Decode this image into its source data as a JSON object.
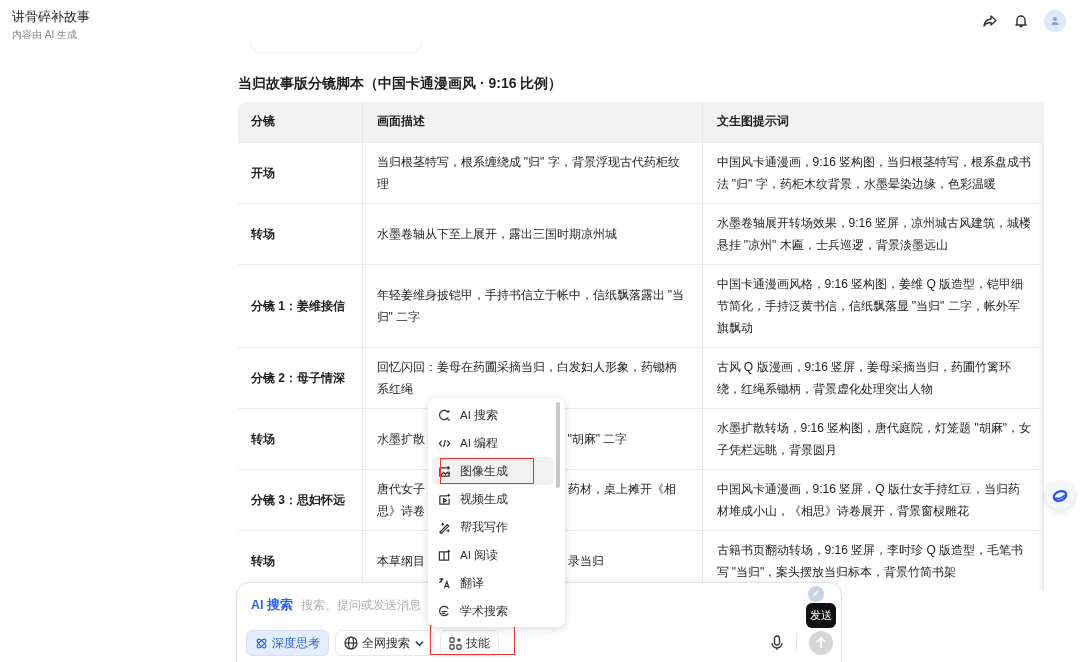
{
  "header": {
    "title": "讲骨碎补故事",
    "subtitle": "内容由 AI 生成"
  },
  "section_title": "当归故事版分镜脚本（中国卡通漫画风 · 9:16 比例）",
  "table": {
    "columns": [
      "分镜",
      "画面描述",
      "文生图提示词"
    ],
    "rows": [
      {
        "shot": "开场",
        "description": [
          [
            "当归根茎特写，根系缠绕成 \"归\" 字，背景浮现古代药柜纹理"
          ]
        ],
        "prompt": "中国风卡通漫画，9:16 竖构图，当归根茎特写，根系盘成书法 \"归\" 字，药柜木纹背景，水墨晕染边缘，色彩温暖"
      },
      {
        "shot": "转场",
        "description": [
          [
            "水墨卷轴从下至上展开，露出三国时期凉州城"
          ]
        ],
        "prompt": "水墨卷轴展开转场效果，9:16 竖屏，凉州城古风建筑，城楼悬挂 \"凉州\" 木匾，士兵巡逻，背景淡墨远山"
      },
      {
        "shot": "分镜 1：姜维接信",
        "description": [
          [
            "年轻姜维身披铠甲，手持书信立于帐中，信纸飘落露出 \"当归\" 二字"
          ]
        ],
        "prompt": "中国卡通漫画风格，9:16 竖构图，姜维 Q 版造型，铠甲细节简化，手持泛黄书信，信纸飘落显 \"当归\" 二字，帐外军旗飘动"
      },
      {
        "shot": "分镜 2：母子情深",
        "description": [
          [
            "回忆闪回：姜母在药圃采摘当归，白发妇人形象，药锄柄系红绳"
          ]
        ],
        "prompt": "古风 Q 版漫画，9:16 竖屏，姜母采摘当归，药圃竹篱环绕，红绳系锄柄，背景虚化处理突出人物"
      },
      {
        "shot": "转场",
        "description": [
          [
            "水墨扩散",
            "\"胡麻\" 二字"
          ]
        ],
        "prompt": "水墨扩散转场，9:16 竖构图，唐代庭院，灯笼题 \"胡麻\"，女子凭栏远眺，背景圆月"
      },
      {
        "shot": "分镜 3：思妇怀远",
        "description": [
          [
            "唐代女子",
            "药材，桌上摊开《相"
          ],
          [
            "思》诗卷"
          ]
        ],
        "prompt": "中国风卡通漫画，9:16 竖屏，Q 版仕女手持红豆，当归药材堆成小山，《相思》诗卷展开，背景窗棂雕花"
      },
      {
        "shot": "转场",
        "description": [
          [
            "本草纲目",
            "录当归"
          ]
        ],
        "prompt": "古籍书页翻动转场，9:16 竖屏，李时珍 Q 版造型，毛笔书写 \"当归\"，案头摆放当归标本，背景竹简书架"
      }
    ]
  },
  "menu": [
    {
      "label": "AI 搜索",
      "selected": false,
      "highlighted": false
    },
    {
      "label": "AI 编程",
      "selected": false,
      "highlighted": false
    },
    {
      "label": "图像生成",
      "selected": true,
      "highlighted": true
    },
    {
      "label": "视频生成",
      "selected": false,
      "highlighted": false
    },
    {
      "label": "帮我写作",
      "selected": false,
      "highlighted": false
    },
    {
      "label": "AI 阅读",
      "selected": false,
      "highlighted": false
    },
    {
      "label": "翻译",
      "selected": false,
      "highlighted": false
    },
    {
      "label": "学术搜索",
      "selected": false,
      "highlighted": false
    }
  ],
  "composer": {
    "mode": "AI 搜索",
    "placeholder": "搜索、提问或发送消息",
    "chips": [
      {
        "kind": "toggle",
        "label": "深度思考",
        "selected": true,
        "highlighted": false
      },
      {
        "kind": "dropdown",
        "label": "全网搜索",
        "selected": false,
        "highlighted": false
      },
      {
        "kind": "skills",
        "label": "技能",
        "selected": false,
        "highlighted": true
      }
    ],
    "send_tooltip": "发送",
    "send_disabled": true
  }
}
